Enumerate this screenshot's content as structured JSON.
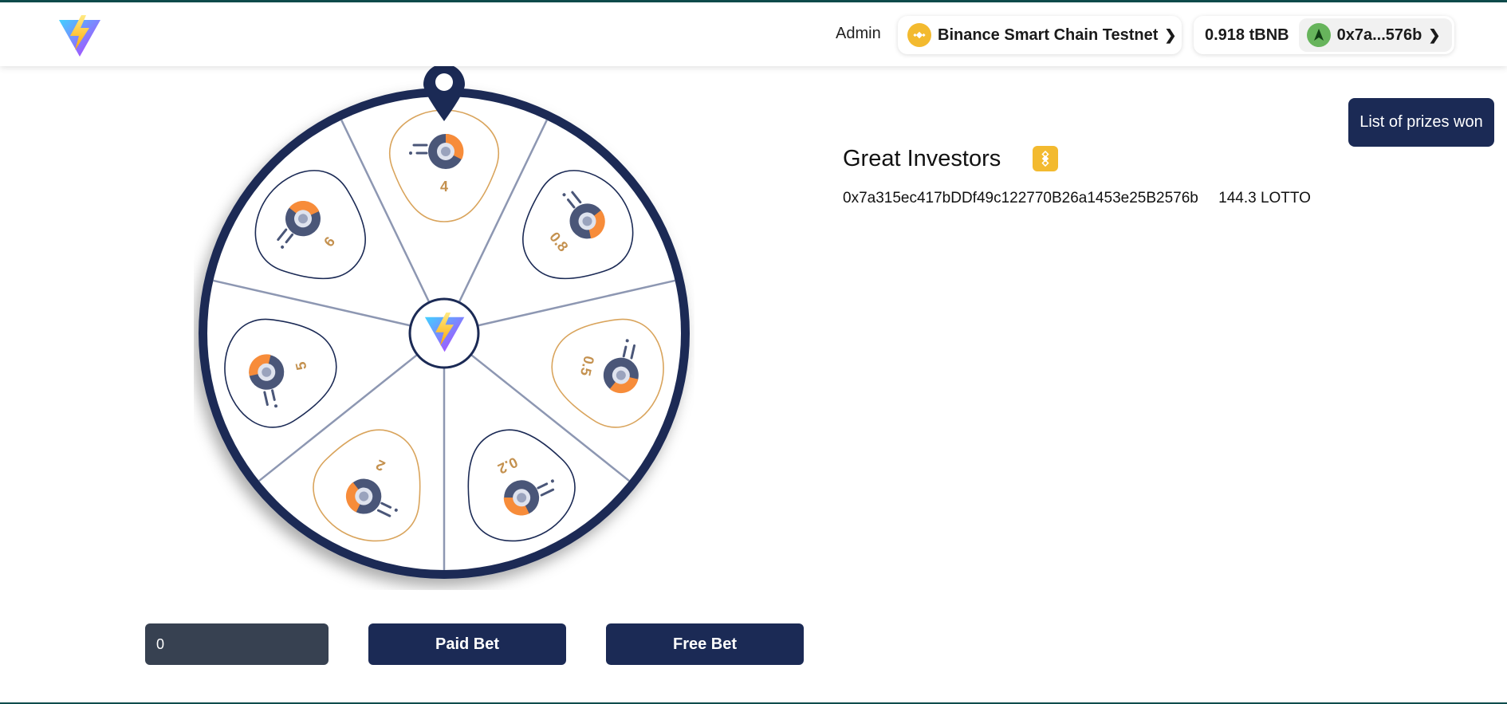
{
  "header": {
    "admin_label": "Admin",
    "network": {
      "name": "Binance Smart Chain Testnet",
      "icon": "bnb-coin-icon"
    },
    "balance": "0.918 tBNB",
    "address": "0x7a...576b"
  },
  "wheel": {
    "segments": [
      {
        "label": "4",
        "style": "gold"
      },
      {
        "label": "0.8",
        "style": "navy"
      },
      {
        "label": "0.5",
        "style": "gold"
      },
      {
        "label": "0.2",
        "style": "navy"
      },
      {
        "label": "2",
        "style": "gold"
      },
      {
        "label": "5",
        "style": "navy"
      },
      {
        "label": "6",
        "style": "navy"
      }
    ]
  },
  "controls": {
    "bet_value": "0",
    "paid_label": "Paid Bet",
    "free_label": "Free Bet"
  },
  "sidebar": {
    "prizes_button": "List of prizes won",
    "investors_title": "Great Investors",
    "investors": [
      {
        "address": "0x7a315ec417bDDf49c122770B26a1453e25B2576b",
        "amount": "144.3 LOTTO"
      }
    ]
  },
  "colors": {
    "navy": "#1b2a55",
    "gold": "#d9a45c",
    "orange": "#f78c3a",
    "bnb": "#f3ba2f",
    "input_bg": "#374151"
  }
}
